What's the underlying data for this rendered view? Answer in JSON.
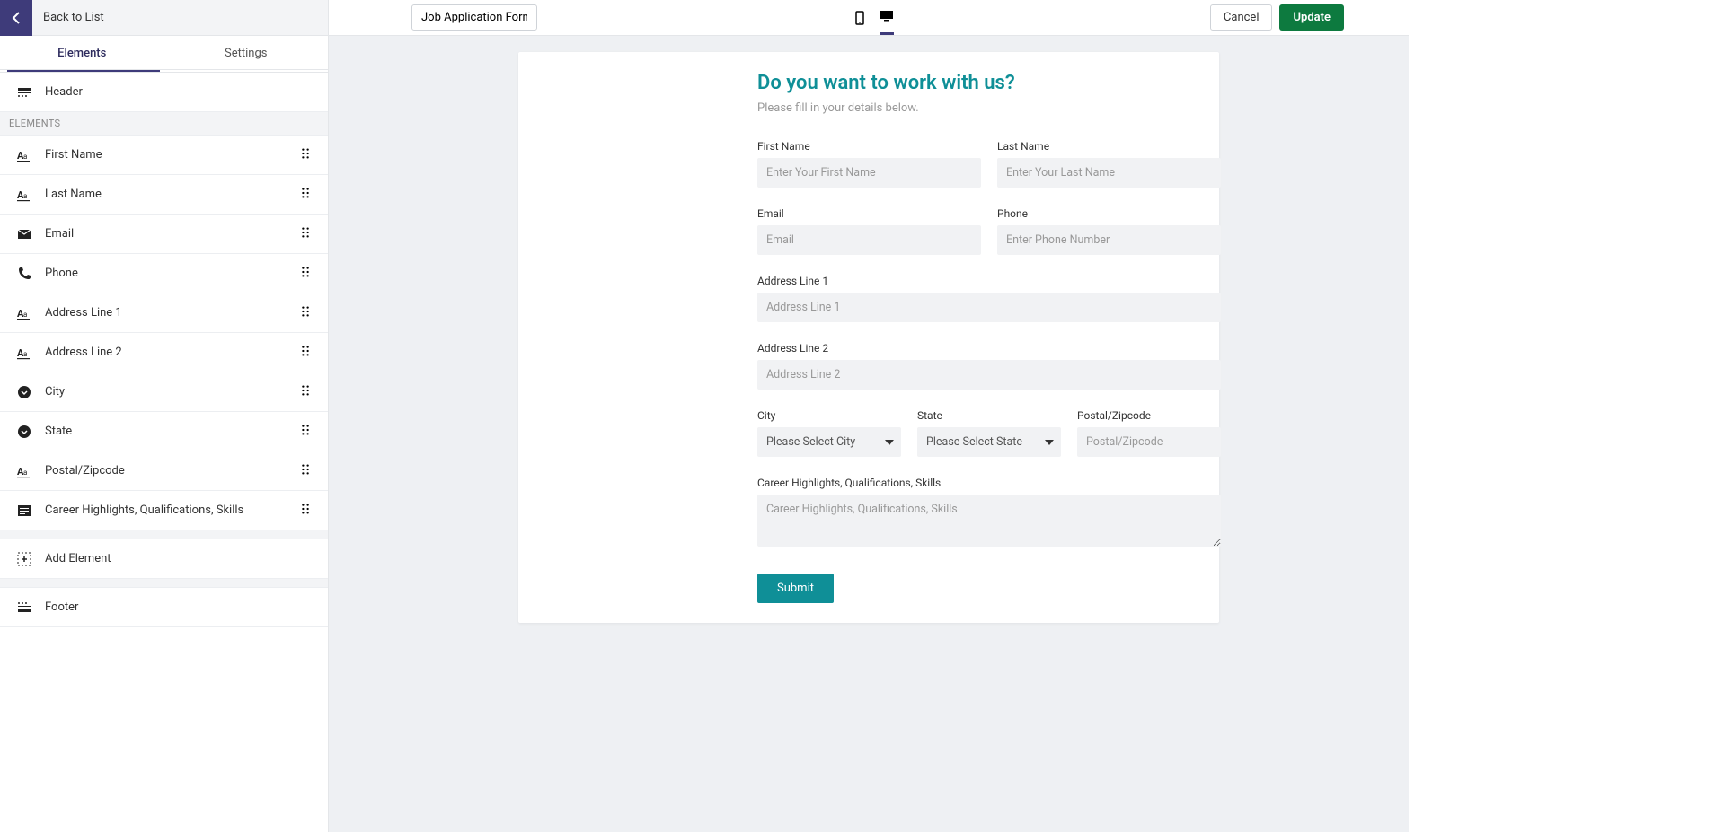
{
  "sidebar": {
    "back_label": "Back to List",
    "tabs": {
      "elements": "Elements",
      "settings": "Settings"
    },
    "header_label": "Header",
    "section_label": "ELEMENTS",
    "items": [
      {
        "label": "First Name",
        "icon": "text"
      },
      {
        "label": "Last Name",
        "icon": "text"
      },
      {
        "label": "Email",
        "icon": "email"
      },
      {
        "label": "Phone",
        "icon": "phone"
      },
      {
        "label": "Address Line 1",
        "icon": "text"
      },
      {
        "label": "Address Line 2",
        "icon": "text"
      },
      {
        "label": "City",
        "icon": "dropdown"
      },
      {
        "label": "State",
        "icon": "dropdown"
      },
      {
        "label": "Postal/Zipcode",
        "icon": "text"
      },
      {
        "label": "Career Highlights, Qualifications, Skills",
        "icon": "textarea"
      }
    ],
    "add_label": "Add Element",
    "footer_label": "Footer"
  },
  "topbar": {
    "form_name": "Job Application Form",
    "cancel": "Cancel",
    "update": "Update"
  },
  "form": {
    "title": "Do you want to work with us?",
    "subtitle": "Please fill in your details below.",
    "fields": {
      "first_name": {
        "label": "First Name",
        "placeholder": "Enter Your First Name"
      },
      "last_name": {
        "label": "Last Name",
        "placeholder": "Enter Your Last Name"
      },
      "email": {
        "label": "Email",
        "placeholder": "Email"
      },
      "phone": {
        "label": "Phone",
        "placeholder": "Enter Phone Number"
      },
      "address1": {
        "label": "Address Line 1",
        "placeholder": "Address Line 1"
      },
      "address2": {
        "label": "Address Line 2",
        "placeholder": "Address Line 2"
      },
      "city": {
        "label": "City",
        "selected": "Please Select City"
      },
      "state": {
        "label": "State",
        "selected": "Please Select State"
      },
      "postal": {
        "label": "Postal/Zipcode",
        "placeholder": "Postal/Zipcode"
      },
      "career": {
        "label": "Career Highlights, Qualifications, Skills",
        "placeholder": "Career Highlights, Qualifications, Skills"
      }
    },
    "submit": "Submit"
  }
}
